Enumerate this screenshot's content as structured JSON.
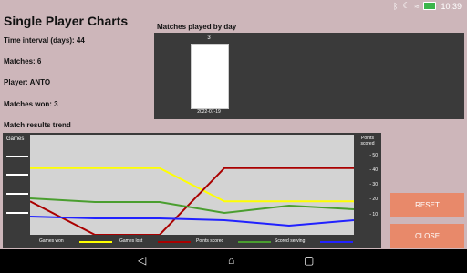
{
  "status": {
    "time": "10:39",
    "icons": [
      "bluetooth-icon",
      "moon-icon",
      "wifi-icon",
      "battery-icon"
    ]
  },
  "header": {
    "title": "Single Player Charts"
  },
  "info": {
    "time_interval": "Time interval (days): 44",
    "matches": "Matches: 6",
    "player": "Player: ANTO",
    "matches_won": "Matches won: 3"
  },
  "bar_chart": {
    "title": "Matches played by day",
    "chart_data": {
      "type": "bar",
      "categories": [
        "2022-07-19"
      ],
      "values": [
        3
      ]
    }
  },
  "trend_chart": {
    "title": "Match results trend",
    "left_axis_label": "Games",
    "right_axis_label": "Points scored",
    "right_ticks": [
      "- 50",
      "- 40",
      "- 30",
      "- 20",
      "- 10"
    ],
    "legend": [
      {
        "label": "Games won",
        "color": "#ffff00"
      },
      {
        "label": "Games lost",
        "color": "#aa0000"
      },
      {
        "label": "Points scored",
        "color": "#4a9e2f"
      },
      {
        "label": "Scored serving",
        "color": "#2222ff"
      }
    ],
    "chart_data": {
      "type": "line",
      "series": [
        {
          "name": "Games won",
          "values": [
            6,
            6,
            6,
            3,
            3,
            3
          ]
        },
        {
          "name": "Games lost",
          "values": [
            3,
            0,
            0,
            6,
            6,
            6
          ]
        },
        {
          "name": "Points scored",
          "values": [
            20,
            18,
            18,
            12,
            16,
            14
          ]
        },
        {
          "name": "Scored serving",
          "values": [
            10,
            9,
            9,
            8,
            5,
            8
          ]
        }
      ],
      "left_ylim": [
        0,
        9
      ],
      "right_ylim": [
        0,
        55
      ]
    }
  },
  "buttons": {
    "reset": "RESET",
    "close": "CLOSE"
  }
}
